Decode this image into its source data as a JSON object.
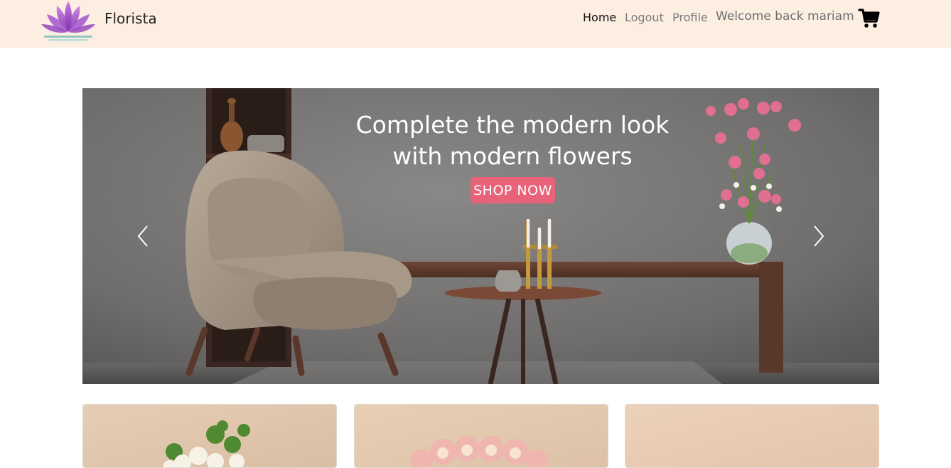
{
  "brand": {
    "name": "Florista",
    "logo_icon": "lotus-logo-icon"
  },
  "nav": {
    "links": [
      {
        "label": "Home",
        "active": true
      },
      {
        "label": "Logout",
        "active": false
      },
      {
        "label": "Profile",
        "active": false
      }
    ],
    "welcome": "Welcome back mariam",
    "cart_icon": "shopping-cart-icon"
  },
  "colors": {
    "navbar_bg": "#fdeee2",
    "accent": "#e8637a",
    "logo_purple": "#9b4fc7"
  },
  "hero": {
    "headline_line1": "Complete the modern look",
    "headline_line2": "with modern flowers",
    "cta_label": "SHOP NOW",
    "prev_icon": "chevron-left-icon",
    "next_icon": "chevron-right-icon"
  },
  "products": [
    {
      "image": "white-flower-bouquet"
    },
    {
      "image": "pink-rose-bouquet"
    },
    {
      "image": "beige-backdrop"
    }
  ]
}
